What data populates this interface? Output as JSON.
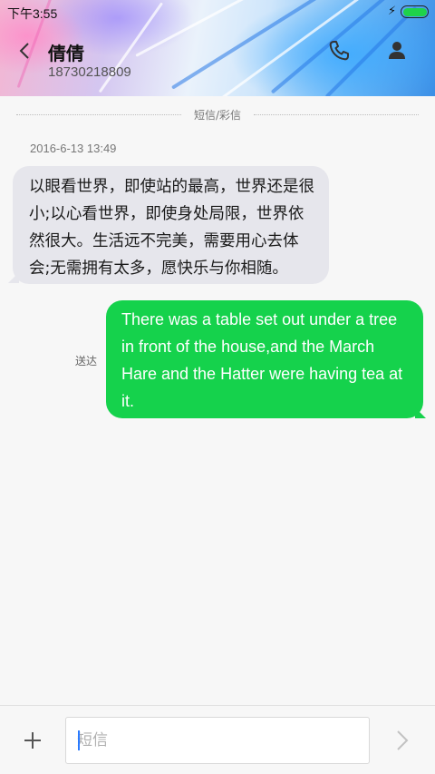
{
  "status_bar": {
    "time": "下午3:55",
    "battery_color": "#1fd24a"
  },
  "header": {
    "contact_name": "倩倩",
    "contact_number": "18730218809",
    "icons": [
      "back-arrow-icon",
      "phone-icon",
      "person-icon"
    ]
  },
  "conversation": {
    "channel_label": "短信/彩信",
    "timestamp": "2016-6-13 13:49",
    "messages": [
      {
        "direction": "incoming",
        "text": "以眼看世界，即使站的最高，世界还是很小;以心看世界，即使身处局限，世界依然很大。生活远不完美，需要用心去体会;无需拥有太多，愿快乐与你相随。",
        "bubble_color": "#e6e6ec"
      },
      {
        "direction": "outgoing",
        "text": "There was a table set out under a tree in front of the house,and the March Hare and the Hatter were having tea at it.",
        "status": "送达",
        "bubble_color": "#15d24c"
      }
    ]
  },
  "composer": {
    "placeholder": "短信",
    "value": "",
    "icons": [
      "plus-icon",
      "send-chevron-icon"
    ]
  }
}
